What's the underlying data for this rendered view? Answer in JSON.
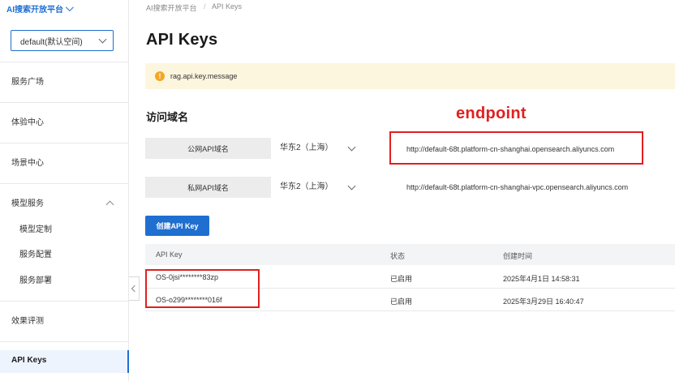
{
  "sidebar": {
    "brand": "AI搜索开放平台",
    "workspace": "default(默认空间)",
    "items": {
      "service_plaza": "服务广场",
      "experience_center": "体验中心",
      "scenario_center": "场景中心",
      "model_service": "模型服务",
      "model_custom": "模型定制",
      "service_config": "服务配置",
      "service_deploy": "服务部署",
      "eval": "效果评测",
      "api_keys": "API Keys"
    }
  },
  "breadcrumb": {
    "root": "AI搜索开放平台",
    "sep": "/",
    "current": "API Keys"
  },
  "page_title": "API Keys",
  "notice": {
    "icon": "warning-icon",
    "text": "rag.api.key.message"
  },
  "domain_section": {
    "title": "访问域名",
    "annotation": "endpoint",
    "public": {
      "label": "公网API域名",
      "region": "华东2（上海）",
      "endpoint": "http://default-68t.platform-cn-shanghai.opensearch.aliyuncs.com"
    },
    "private": {
      "label": "私网API域名",
      "region": "华东2（上海）",
      "endpoint": "http://default-68t.platform-cn-shanghai-vpc.opensearch.aliyuncs.com"
    }
  },
  "create_button": "创建API Key",
  "table": {
    "headers": {
      "key": "API Key",
      "status": "状态",
      "created": "创建时间"
    },
    "rows": [
      {
        "key": "OS-0jsi********83zp",
        "status": "已启用",
        "created": "2025年4月1日 14:58:31"
      },
      {
        "key": "OS-o299********016f",
        "status": "已启用",
        "created": "2025年3月29日 16:40:47"
      }
    ]
  },
  "colors": {
    "accent": "#1f6fd1",
    "annotation": "#e02020",
    "notice_bg": "#fdf6de",
    "warning": "#f5a623"
  }
}
